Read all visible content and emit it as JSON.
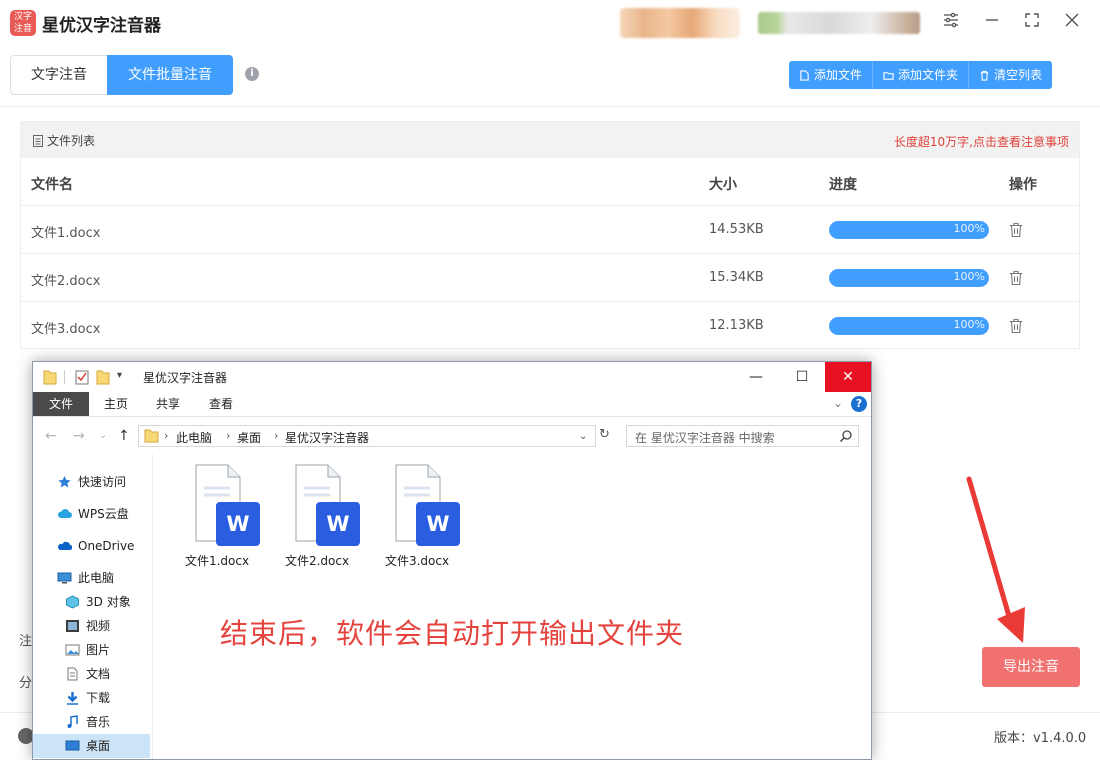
{
  "app": {
    "title": "星优汉字注音器",
    "logo_text": "汉字注音",
    "accent_color": "#409eff"
  },
  "tabs": [
    {
      "label": "文字注音",
      "active": false
    },
    {
      "label": "文件批量注音",
      "active": true
    }
  ],
  "toolbar": {
    "add_file": "添加文件",
    "add_folder": "添加文件夹",
    "clear_list": "清空列表"
  },
  "file_list": {
    "title": "文件列表",
    "notice": "长度超10万字,点击查看注意事项",
    "columns": [
      "文件名",
      "大小",
      "进度",
      "操作"
    ],
    "rows": [
      {
        "name": "文件1.docx",
        "size": "14.53KB",
        "progress_text": "100%",
        "progress": 1.0
      },
      {
        "name": "文件2.docx",
        "size": "15.34KB",
        "progress_text": "100%",
        "progress": 1.0
      },
      {
        "name": "文件3.docx",
        "size": "12.13KB",
        "progress_text": "100%",
        "progress": 1.0
      }
    ]
  },
  "side_fragments": [
    "注",
    "分"
  ],
  "export_button": "导出注音",
  "version": "版本：v1.4.0.0",
  "explorer": {
    "title": "星优汉字注音器",
    "ribbon_tabs": [
      "文件",
      "主页",
      "共享",
      "查看"
    ],
    "address": [
      "此电脑",
      "桌面",
      "星优汉字注音器"
    ],
    "search_placeholder": "在 星优汉字注音器 中搜索",
    "nav_items": [
      {
        "label": "快速访问",
        "icon": "star-icon"
      },
      {
        "label": "WPS云盘",
        "icon": "cloud-icon"
      },
      {
        "label": "OneDrive",
        "icon": "onedrive-icon"
      },
      {
        "label": "此电脑",
        "icon": "computer-icon"
      },
      {
        "label": "3D 对象",
        "icon": "cube-icon"
      },
      {
        "label": "视频",
        "icon": "video-icon"
      },
      {
        "label": "图片",
        "icon": "picture-icon"
      },
      {
        "label": "文档",
        "icon": "document-icon"
      },
      {
        "label": "下载",
        "icon": "download-icon"
      },
      {
        "label": "音乐",
        "icon": "music-icon"
      },
      {
        "label": "桌面",
        "icon": "desktop-icon",
        "selected": true
      }
    ],
    "files": [
      "文件1.docx",
      "文件2.docx",
      "文件3.docx"
    ]
  },
  "annotation": "结束后，软件会自动打开输出文件夹"
}
